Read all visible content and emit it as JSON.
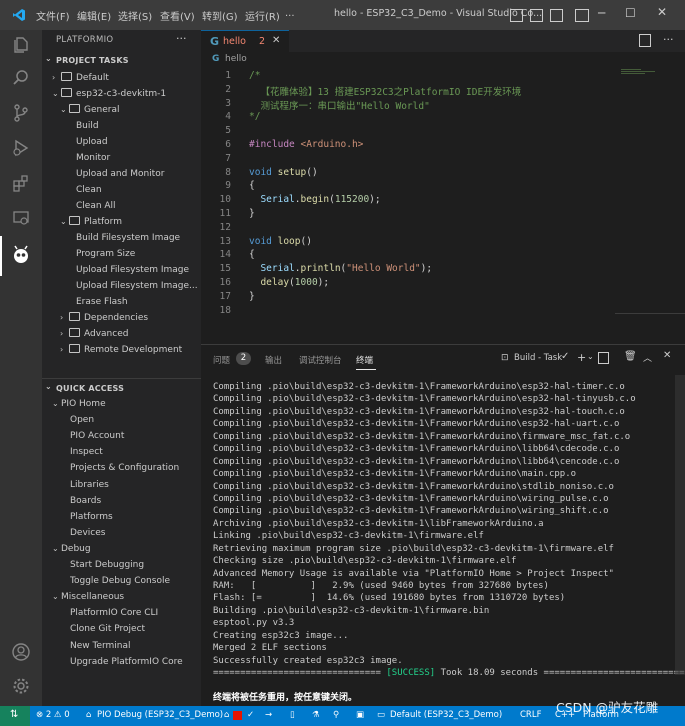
{
  "titlebar": {
    "menus": [
      "文件(F)",
      "编辑(E)",
      "选择(S)",
      "查看(V)",
      "转到(G)",
      "运行(R)",
      "..."
    ],
    "title": "hello - ESP32_C3_Demo - Visual Studio Co...",
    "icon": "vscode-logo-icon"
  },
  "sidebar": {
    "title": "PLATFORMIO",
    "more": "···",
    "project_tasks": {
      "header": "PROJECT TASKS",
      "items": [
        {
          "label": "Default",
          "indent": 1,
          "type": "folder",
          "chev": "›"
        },
        {
          "label": "esp32-c3-devkitm-1",
          "indent": 1,
          "type": "folder",
          "chev": "⌄"
        },
        {
          "label": "General",
          "indent": 2,
          "type": "folder",
          "chev": "⌄"
        },
        {
          "label": "Build",
          "indent": 3,
          "type": "task"
        },
        {
          "label": "Upload",
          "indent": 3,
          "type": "task"
        },
        {
          "label": "Monitor",
          "indent": 3,
          "type": "task"
        },
        {
          "label": "Upload and Monitor",
          "indent": 3,
          "type": "task"
        },
        {
          "label": "Clean",
          "indent": 3,
          "type": "task"
        },
        {
          "label": "Clean All",
          "indent": 3,
          "type": "task"
        },
        {
          "label": "Platform",
          "indent": 2,
          "type": "folder",
          "chev": "⌄"
        },
        {
          "label": "Build Filesystem Image",
          "indent": 3,
          "type": "task"
        },
        {
          "label": "Program Size",
          "indent": 3,
          "type": "task"
        },
        {
          "label": "Upload Filesystem Image",
          "indent": 3,
          "type": "task"
        },
        {
          "label": "Upload Filesystem Image...",
          "indent": 3,
          "type": "task"
        },
        {
          "label": "Erase Flash",
          "indent": 3,
          "type": "task"
        },
        {
          "label": "Dependencies",
          "indent": 2,
          "type": "folder",
          "chev": "›"
        },
        {
          "label": "Advanced",
          "indent": 2,
          "type": "folder",
          "chev": "›"
        },
        {
          "label": "Remote Development",
          "indent": 2,
          "type": "folder",
          "chev": "›"
        }
      ]
    },
    "quick_access": {
      "header": "QUICK ACCESS",
      "items": [
        {
          "label": "PIO Home",
          "indent": 1,
          "chev": "⌄"
        },
        {
          "label": "Open",
          "indent": 2
        },
        {
          "label": "PIO Account",
          "indent": 2
        },
        {
          "label": "Inspect",
          "indent": 2
        },
        {
          "label": "Projects & Configuration",
          "indent": 2
        },
        {
          "label": "Libraries",
          "indent": 2
        },
        {
          "label": "Boards",
          "indent": 2
        },
        {
          "label": "Platforms",
          "indent": 2
        },
        {
          "label": "Devices",
          "indent": 2
        },
        {
          "label": "Debug",
          "indent": 1,
          "chev": "⌄"
        },
        {
          "label": "Start Debugging",
          "indent": 2
        },
        {
          "label": "Toggle Debug Console",
          "indent": 2
        },
        {
          "label": "Miscellaneous",
          "indent": 1,
          "chev": "⌄"
        },
        {
          "label": "PlatformIO Core CLI",
          "indent": 2
        },
        {
          "label": "Clone Git Project",
          "indent": 2
        },
        {
          "label": "New Terminal",
          "indent": 2
        },
        {
          "label": "Upgrade PlatformIO Core",
          "indent": 2
        }
      ]
    }
  },
  "editor": {
    "tab_label": "hello",
    "tab_badge": "2",
    "breadcrumb": "hello",
    "lines": [
      {
        "n": "1",
        "parts": [
          {
            "c": "cm",
            "t": "/*"
          }
        ]
      },
      {
        "n": "2",
        "parts": [
          {
            "c": "cm",
            "t": "  【花雕体验】13 搭建ESP32C3之PlatformIO IDE开发环境"
          }
        ]
      },
      {
        "n": "3",
        "parts": [
          {
            "c": "cm",
            "t": "  测试程序一：串口输出\"Hello World\""
          }
        ]
      },
      {
        "n": "4",
        "parts": [
          {
            "c": "cm",
            "t": "*/"
          }
        ]
      },
      {
        "n": "5",
        "parts": []
      },
      {
        "n": "6",
        "parts": [
          {
            "c": "pp",
            "t": "#include "
          },
          {
            "c": "inc",
            "t": "<Arduino.h>"
          }
        ]
      },
      {
        "n": "7",
        "parts": []
      },
      {
        "n": "8",
        "parts": [
          {
            "c": "kw",
            "t": "void "
          },
          {
            "c": "fn",
            "t": "setup"
          },
          {
            "c": "pl",
            "t": "()"
          }
        ]
      },
      {
        "n": "9",
        "parts": [
          {
            "c": "pl",
            "t": "{"
          }
        ]
      },
      {
        "n": "10",
        "parts": [
          {
            "c": "id",
            "t": "  Serial"
          },
          {
            "c": "pl",
            "t": "."
          },
          {
            "c": "fn",
            "t": "begin"
          },
          {
            "c": "pl",
            "t": "("
          },
          {
            "c": "num",
            "t": "115200"
          },
          {
            "c": "pl",
            "t": ");"
          }
        ]
      },
      {
        "n": "11",
        "parts": [
          {
            "c": "pl",
            "t": "}"
          }
        ]
      },
      {
        "n": "12",
        "parts": []
      },
      {
        "n": "13",
        "parts": [
          {
            "c": "kw",
            "t": "void "
          },
          {
            "c": "fn",
            "t": "loop"
          },
          {
            "c": "pl",
            "t": "()"
          }
        ]
      },
      {
        "n": "14",
        "parts": [
          {
            "c": "pl",
            "t": "{"
          }
        ]
      },
      {
        "n": "15",
        "parts": [
          {
            "c": "id",
            "t": "  Serial"
          },
          {
            "c": "pl",
            "t": "."
          },
          {
            "c": "fn",
            "t": "println"
          },
          {
            "c": "pl",
            "t": "("
          },
          {
            "c": "str",
            "t": "\"Hello World\""
          },
          {
            "c": "pl",
            "t": ");"
          }
        ]
      },
      {
        "n": "16",
        "parts": [
          {
            "c": "fn",
            "t": "  delay"
          },
          {
            "c": "pl",
            "t": "("
          },
          {
            "c": "num",
            "t": "1000"
          },
          {
            "c": "pl",
            "t": ");"
          }
        ]
      },
      {
        "n": "17",
        "parts": [
          {
            "c": "pl",
            "t": "}"
          }
        ]
      },
      {
        "n": "18",
        "parts": []
      }
    ]
  },
  "panel": {
    "tabs": [
      {
        "label": "问题",
        "badge": "2"
      },
      {
        "label": "输出"
      },
      {
        "label": "调试控制台"
      },
      {
        "label": "终端"
      }
    ],
    "task_label": "Build - Task",
    "terminal_lines": [
      "Compiling .pio\\build\\esp32-c3-devkitm-1\\FrameworkArduino\\esp32-hal-timer.c.o",
      "Compiling .pio\\build\\esp32-c3-devkitm-1\\FrameworkArduino\\esp32-hal-tinyusb.c.o",
      "Compiling .pio\\build\\esp32-c3-devkitm-1\\FrameworkArduino\\esp32-hal-touch.c.o",
      "Compiling .pio\\build\\esp32-c3-devkitm-1\\FrameworkArduino\\esp32-hal-uart.c.o",
      "Compiling .pio\\build\\esp32-c3-devkitm-1\\FrameworkArduino\\firmware_msc_fat.c.o",
      "Compiling .pio\\build\\esp32-c3-devkitm-1\\FrameworkArduino\\libb64\\cdecode.c.o",
      "Compiling .pio\\build\\esp32-c3-devkitm-1\\FrameworkArduino\\libb64\\cencode.c.o",
      "Compiling .pio\\build\\esp32-c3-devkitm-1\\FrameworkArduino\\main.cpp.o",
      "Compiling .pio\\build\\esp32-c3-devkitm-1\\FrameworkArduino\\stdlib_noniso.c.o",
      "Compiling .pio\\build\\esp32-c3-devkitm-1\\FrameworkArduino\\wiring_pulse.c.o",
      "Compiling .pio\\build\\esp32-c3-devkitm-1\\FrameworkArduino\\wiring_shift.c.o",
      "Archiving .pio\\build\\esp32-c3-devkitm-1\\libFrameworkArduino.a",
      "Linking .pio\\build\\esp32-c3-devkitm-1\\firmware.elf",
      "Retrieving maximum program size .pio\\build\\esp32-c3-devkitm-1\\firmware.elf",
      "Checking size .pio\\build\\esp32-c3-devkitm-1\\firmware.elf",
      "Advanced Memory Usage is available via \"PlatformIO Home > Project Inspect\"",
      "RAM:   [          ]   2.9% (used 9460 bytes from 327680 bytes)",
      "Flash: [=         ]  14.6% (used 191680 bytes from 1310720 bytes)",
      "Building .pio\\build\\esp32-c3-devkitm-1\\firmware.bin",
      "esptool.py v3.3",
      "Creating esp32c3 image...",
      "Merged 2 ELF sections",
      "Successfully created esp32c3 image."
    ],
    "success_prefix": "=============================== ",
    "success_tag": "[SUCCESS]",
    "success_suffix": " Took 18.09 seconds ================================",
    "reuse_msg": "终端将被任务重用，按任意键关闭。"
  },
  "statusbar": {
    "errors": "⊗ 2 ⚠ 0",
    "pio_debug": "PIO Debug (ESP32_C3_Demo)",
    "env": "Default (ESP32_C3_Demo)",
    "lang": "C++",
    "platform": "Platform",
    "crlf": "CRLF"
  },
  "watermark": "CSDN @驴友花雕"
}
